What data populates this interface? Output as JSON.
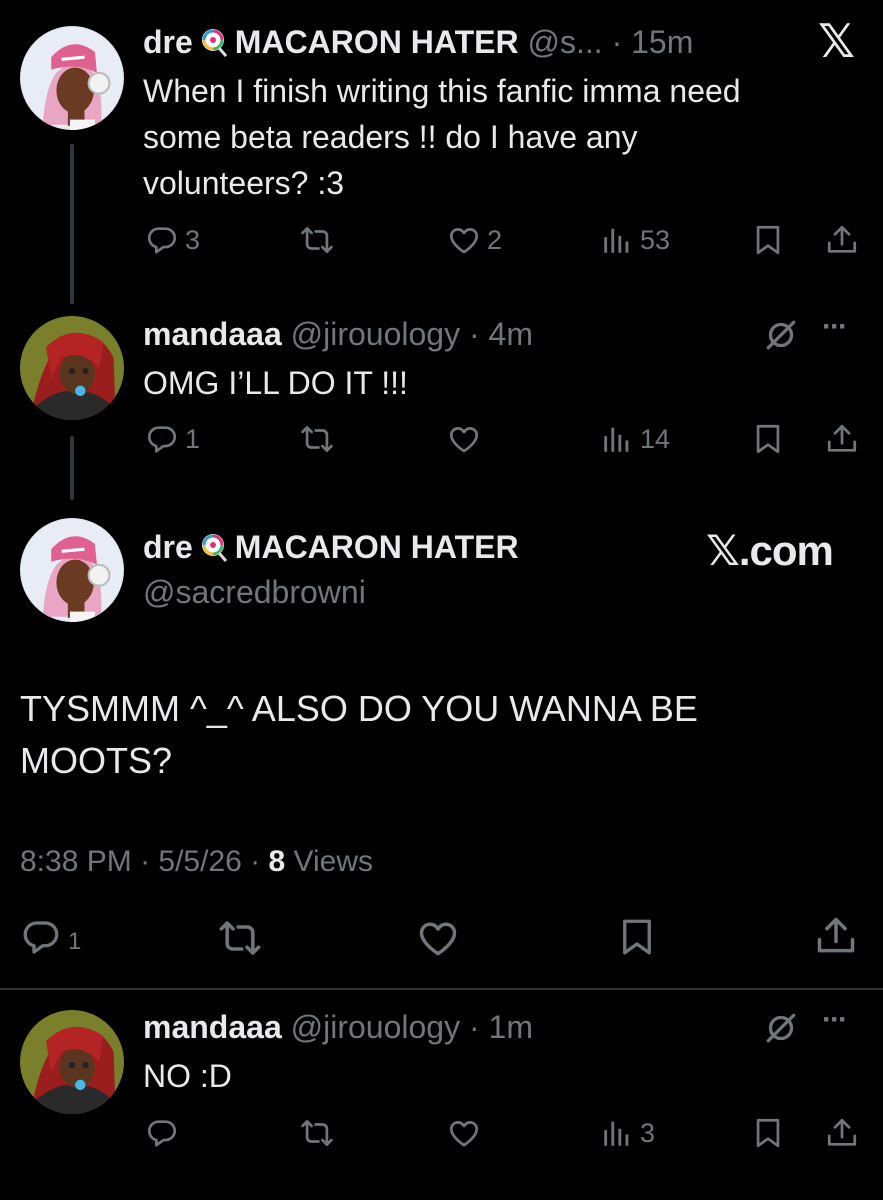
{
  "tweet1": {
    "display_name": "dre",
    "display_name_rest": "MACARON HATER",
    "handle": "@s...",
    "time": "15m",
    "text_lines": [
      "When I finish writing this fanfic imma need",
      "some beta readers !! do I have any",
      "volunteers? :3"
    ],
    "replies": "3",
    "likes": "2",
    "views": "53",
    "logo": "𝕏"
  },
  "reply1": {
    "display_name": "mandaaa",
    "handle": "@jirouology",
    "time": "4m",
    "text": "OMG I’LL DO IT !!!",
    "replies": "1",
    "views": "14",
    "more": "···"
  },
  "main": {
    "display_name": "dre",
    "display_name_rest": "MACARON HATER",
    "handle": "@sacredbrowni",
    "brand": "𝕏.com",
    "text_lines": [
      "TYSMMM ^_^ ALSO DO YOU WANNA BE",
      "MOOTS?"
    ],
    "time": "8:38 PM",
    "date": "5/5/26",
    "views_count": "8",
    "views_label": "Views",
    "replies": "1"
  },
  "reply2": {
    "display_name": "mandaaa",
    "handle": "@jirouology",
    "time": "1m",
    "text": "NO :D",
    "views": "3",
    "more": "···"
  },
  "colors": {
    "bg": "#000000",
    "text": "#e7e9ea",
    "muted": "#71767b",
    "divider": "#2f3336",
    "thread": "#333639"
  },
  "icons": [
    "reply-icon",
    "retweet-icon",
    "like-icon",
    "views-icon",
    "bookmark-icon",
    "share-icon",
    "grok-icon",
    "more-icon",
    "x-logo-icon",
    "lollipop-emoji"
  ]
}
